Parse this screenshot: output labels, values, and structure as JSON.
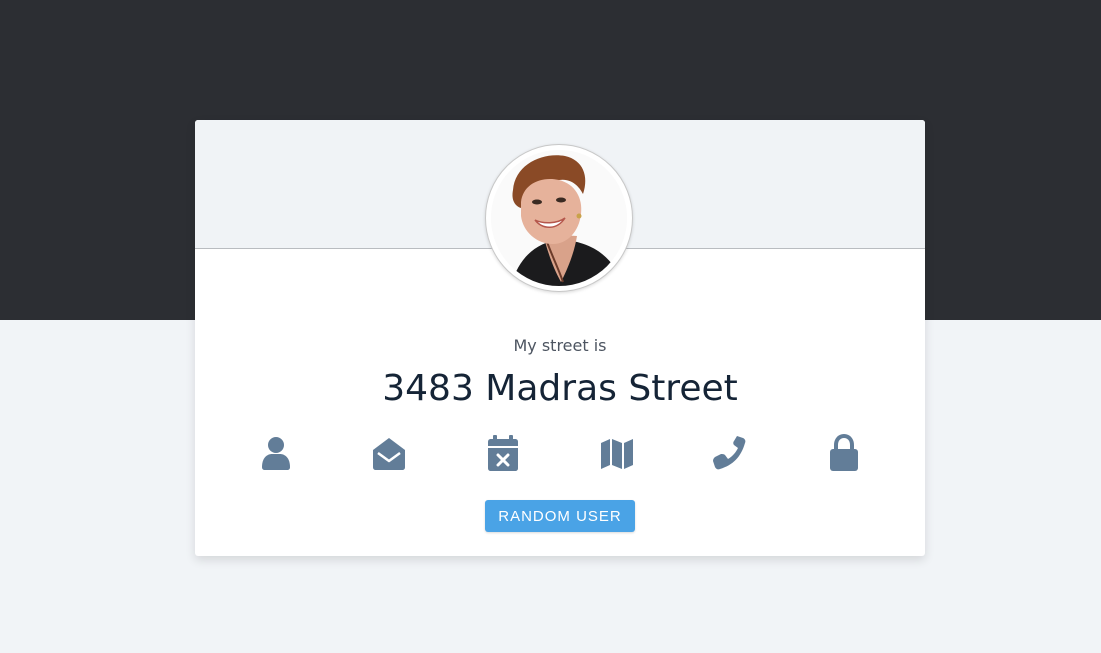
{
  "colors": {
    "top_background": "#2c2e33",
    "bottom_background": "#f1f4f7",
    "icon": "#627d98",
    "button": "#4aa3e6"
  },
  "card": {
    "label": "My street is",
    "value": "3483 Madras Street",
    "icons": [
      {
        "name": "user-icon"
      },
      {
        "name": "envelope-open-icon"
      },
      {
        "name": "calendar-times-icon"
      },
      {
        "name": "map-icon"
      },
      {
        "name": "phone-icon"
      },
      {
        "name": "lock-icon"
      }
    ],
    "button_label": "RANDOM USER"
  }
}
